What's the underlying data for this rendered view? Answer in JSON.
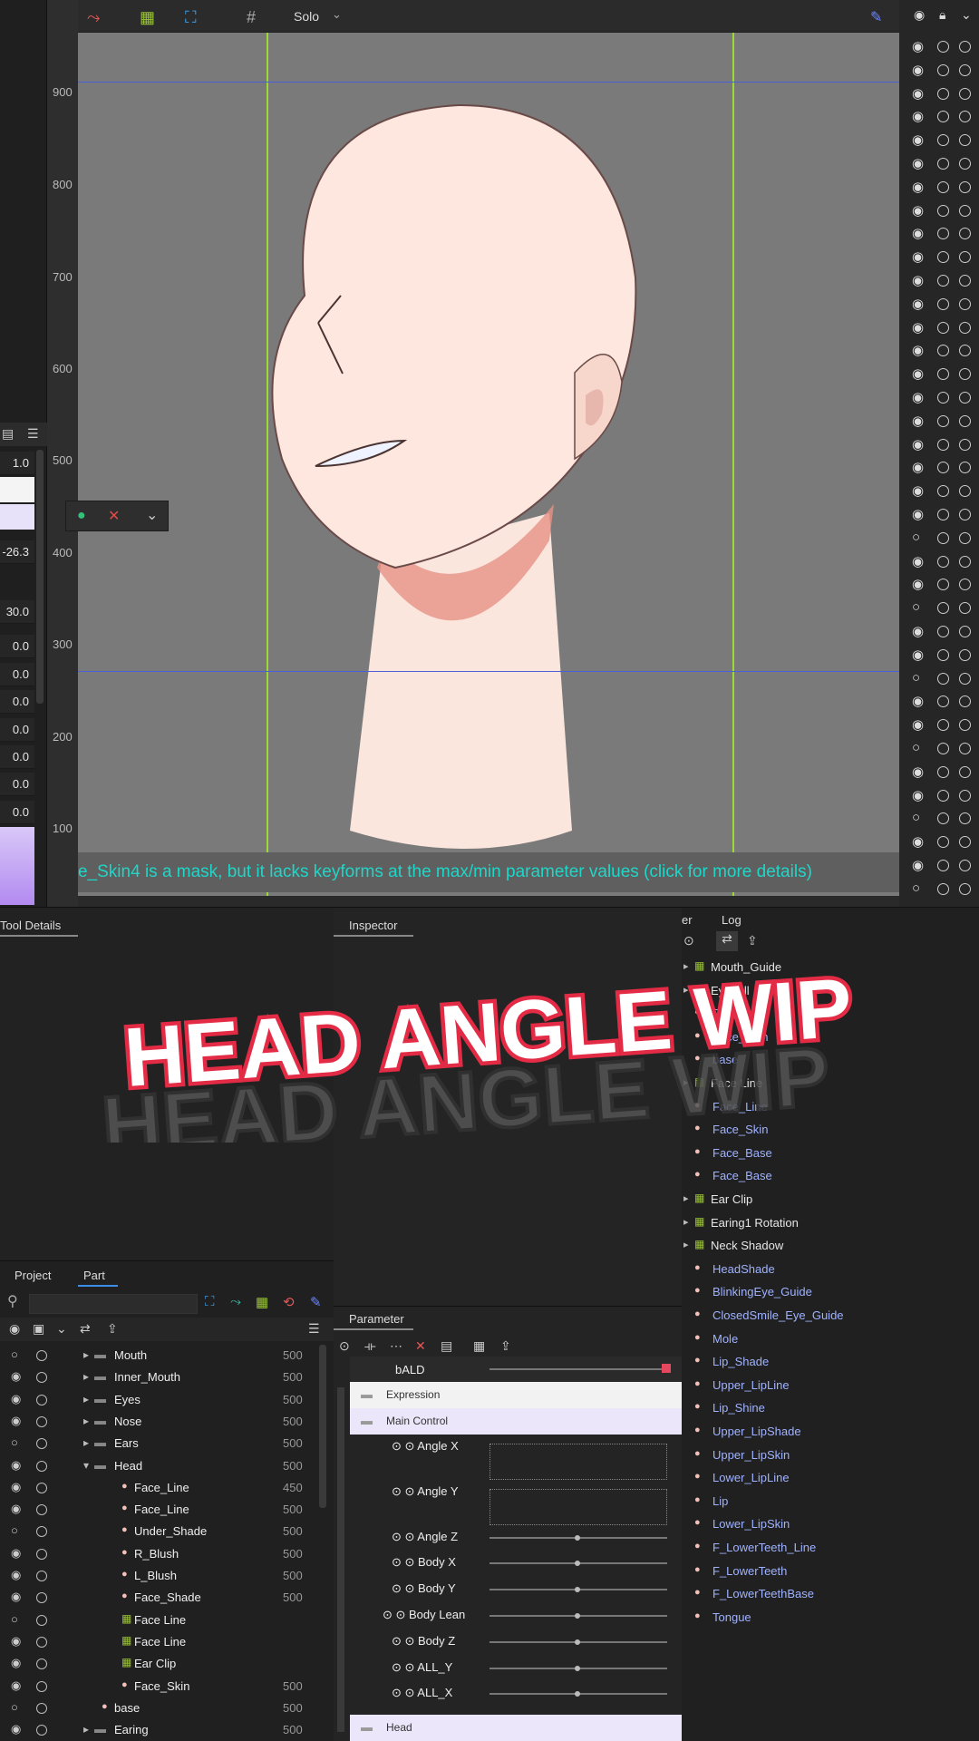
{
  "canvas": {
    "toolbar": {
      "solo_label": "Solo",
      "solo_caret": "⌄"
    },
    "ruler_ticks": [
      "900",
      "800",
      "700",
      "600",
      "500",
      "400",
      "300",
      "200",
      "100"
    ],
    "warning": "e_Skin4 is a mask, but it lacks keyforms at the max/min parameter values (click for more details)",
    "colors": {
      "bg": "#7a7a7a",
      "guide_green": "#9ddb33",
      "guide_blue": "#4a5fd8",
      "warning_text": "#1fd6c8"
    }
  },
  "left_panel": {
    "values": [
      "1.0",
      "-26.3",
      "30.0",
      "0.0",
      "0.0",
      "0.0",
      "0.0",
      "0.0",
      "0.0",
      "0.0"
    ]
  },
  "panels": {
    "tool_details": "Tool Details",
    "inspector": "Inspector",
    "project_tab": "Project",
    "part_tab": "Part",
    "parameter_tab": "Parameter",
    "deformer_tab_partial": "er",
    "log_tab": "Log"
  },
  "overlay_title": "HEAD ANGLE WIP",
  "part_list": [
    {
      "name": "Mouth",
      "num": "500",
      "indent": 0,
      "kind": "folder"
    },
    {
      "name": "Inner_Mouth",
      "num": "500",
      "indent": 0,
      "kind": "folder"
    },
    {
      "name": "Eyes",
      "num": "500",
      "indent": 0,
      "kind": "folder"
    },
    {
      "name": "Nose",
      "num": "500",
      "indent": 0,
      "kind": "folder"
    },
    {
      "name": "Ears",
      "num": "500",
      "indent": 0,
      "kind": "folder"
    },
    {
      "name": "Head",
      "num": "500",
      "indent": 0,
      "kind": "folder-open"
    },
    {
      "name": "Face_Line",
      "num": "450",
      "indent": 1,
      "kind": "art"
    },
    {
      "name": "Face_Line",
      "num": "500",
      "indent": 1,
      "kind": "art"
    },
    {
      "name": "Under_Shade",
      "num": "500",
      "indent": 1,
      "kind": "art"
    },
    {
      "name": "R_Blush",
      "num": "500",
      "indent": 1,
      "kind": "art"
    },
    {
      "name": "L_Blush",
      "num": "500",
      "indent": 1,
      "kind": "art"
    },
    {
      "name": "Face_Shade",
      "num": "500",
      "indent": 1,
      "kind": "art"
    },
    {
      "name": "Face Line",
      "num": "",
      "indent": 1,
      "kind": "deformer"
    },
    {
      "name": "Face Line",
      "num": "",
      "indent": 1,
      "kind": "deformer"
    },
    {
      "name": "Ear Clip",
      "num": "",
      "indent": 1,
      "kind": "deformer"
    },
    {
      "name": "Face_Skin",
      "num": "500",
      "indent": 1,
      "kind": "art"
    },
    {
      "name": "base",
      "num": "500",
      "indent": 0,
      "kind": "art"
    },
    {
      "name": "Earing",
      "num": "500",
      "indent": 0,
      "kind": "folder"
    }
  ],
  "parameters": {
    "top": "bALD",
    "groups": [
      {
        "name": "Expression"
      },
      {
        "name": "Main Control"
      }
    ],
    "rows": [
      {
        "name": "Angle X"
      },
      {
        "name": "Angle Y"
      },
      {
        "name": "Angle Z"
      },
      {
        "name": "Body X"
      },
      {
        "name": "Body Y"
      },
      {
        "name": "Body Lean"
      },
      {
        "name": "Body Z"
      },
      {
        "name": "ALL_Y"
      },
      {
        "name": "ALL_X"
      }
    ],
    "bottom_group": "Head"
  },
  "deformers": [
    {
      "name": "Mouth_Guide",
      "color": "#e6e6e6"
    },
    {
      "name": "Eyeball",
      "color": "#e6e6e6"
    },
    {
      "name": "Face_Line",
      "color": "#9fb2ff"
    },
    {
      "name": "Face_Skin",
      "color": "#9fb2ff"
    },
    {
      "name": "base",
      "color": "#9fb2ff"
    },
    {
      "name": "Face Line",
      "color": "#e6e6e6"
    },
    {
      "name": "Face_Line",
      "color": "#9fb2ff"
    },
    {
      "name": "Face_Skin",
      "color": "#9fb2ff"
    },
    {
      "name": "Face_Base",
      "color": "#9fb2ff"
    },
    {
      "name": "Face_Base",
      "color": "#9fb2ff"
    },
    {
      "name": "Ear Clip",
      "color": "#e6e6e6"
    },
    {
      "name": "Earing1 Rotation",
      "color": "#e6e6e6"
    },
    {
      "name": "Neck Shadow",
      "color": "#e6e6e6"
    },
    {
      "name": "HeadShade",
      "color": "#9fb2ff"
    },
    {
      "name": "BlinkingEye_Guide",
      "color": "#9fb2ff"
    },
    {
      "name": "ClosedSmile_Eye_Guide",
      "color": "#9fb2ff"
    },
    {
      "name": "Mole",
      "color": "#9fb2ff"
    },
    {
      "name": "Lip_Shade",
      "color": "#9fb2ff"
    },
    {
      "name": "Upper_LipLine",
      "color": "#9fb2ff"
    },
    {
      "name": "Lip_Shine",
      "color": "#9fb2ff"
    },
    {
      "name": "Upper_LipShade",
      "color": "#9fb2ff"
    },
    {
      "name": "Upper_LipSkin",
      "color": "#9fb2ff"
    },
    {
      "name": "Lower_LipLine",
      "color": "#9fb2ff"
    },
    {
      "name": "Lip",
      "color": "#9fb2ff"
    },
    {
      "name": "Lower_LipSkin",
      "color": "#9fb2ff"
    },
    {
      "name": "F_LowerTeeth_Line",
      "color": "#9fb2ff"
    },
    {
      "name": "F_LowerTeeth",
      "color": "#9fb2ff"
    },
    {
      "name": "F_LowerTeethBase",
      "color": "#9fb2ff"
    },
    {
      "name": "Tongue",
      "color": "#9fb2ff"
    }
  ]
}
